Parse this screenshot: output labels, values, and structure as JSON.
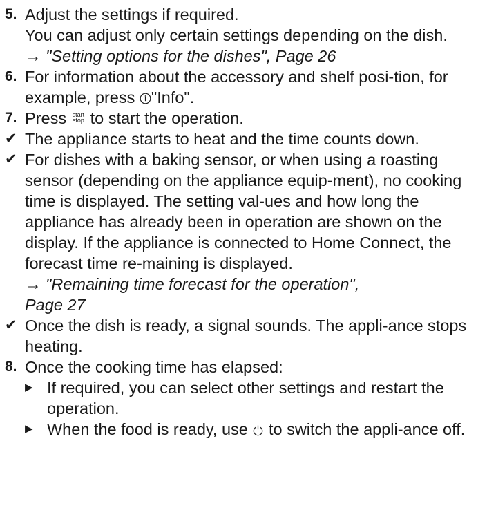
{
  "steps": {
    "s5": {
      "num": "5.",
      "text": "Adjust the settings if required.",
      "note": "You can adjust only certain settings depending on the dish.",
      "ref_arrow": "→",
      "ref": "\"Setting options for the dishes\", Page 26"
    },
    "s6": {
      "num": "6.",
      "text_before": "For information about the accessory and shelf posi-tion, for example, press",
      "text_after": "\"Info\"."
    },
    "s7": {
      "num": "7.",
      "text_before": "Press",
      "btn_top": "start",
      "btn_bottom": "stop",
      "text_after": "to start the operation."
    },
    "r1": "The appliance starts to heat and the time counts down.",
    "r2": {
      "text": "For dishes with a baking sensor, or when using a roasting sensor (depending on the appliance equip-ment), no cooking time is displayed. The setting val-ues and how long the appliance has already been in operation are shown on the display. If the appliance is connected to Home Connect, the forecast time re-maining is displayed.",
      "ref_arrow": "→",
      "ref_line1": "\"Remaining time forecast for the operation\",",
      "ref_line2": "Page 27"
    },
    "r3": "Once the dish is ready, a signal sounds. The appli-ance stops heating.",
    "s8": {
      "num": "8.",
      "text": "Once the cooking time has elapsed:",
      "sub1": "If required, you can select other settings and restart the operation.",
      "sub2_before": "When the food is ready, use",
      "sub2_after": "to switch the appli-ance off."
    }
  },
  "icons": {
    "check": "check-icon",
    "bullet": "triangle-bullet-icon",
    "info": "info-icon",
    "power": "power-icon",
    "start_stop": "start-stop-icon"
  }
}
